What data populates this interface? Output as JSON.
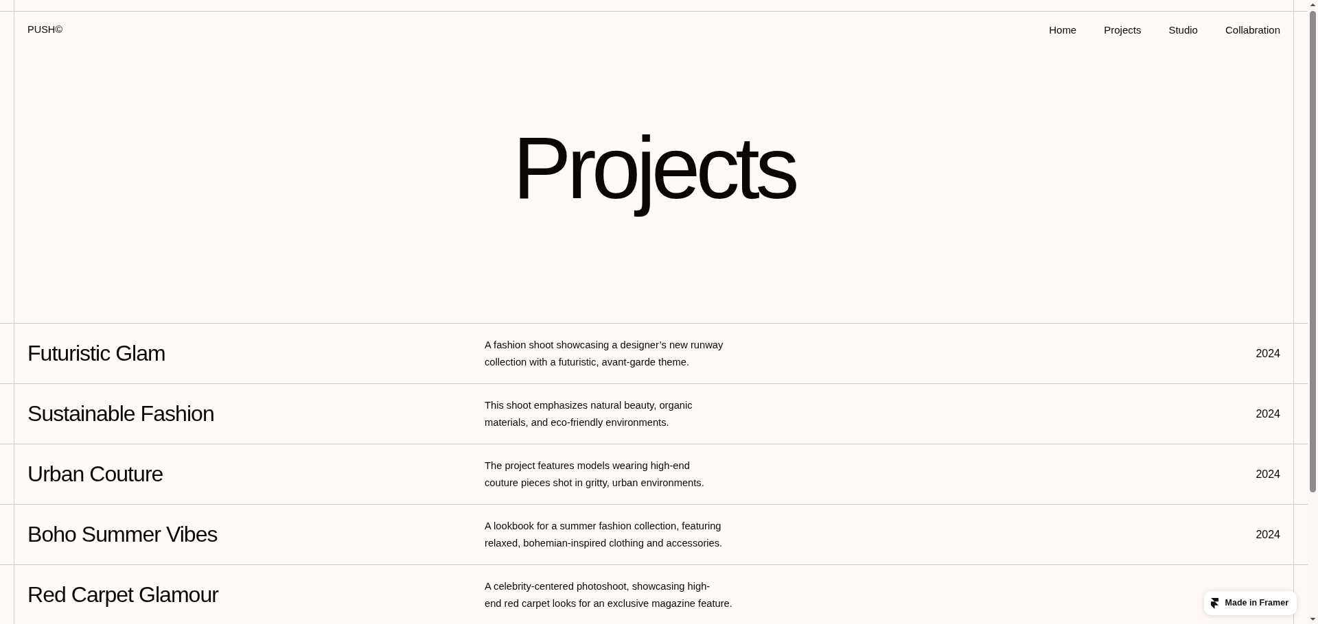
{
  "header": {
    "logo": "PUSH©",
    "nav": [
      {
        "label": "Home"
      },
      {
        "label": "Projects"
      },
      {
        "label": "Studio"
      },
      {
        "label": "Collabration"
      }
    ]
  },
  "hero": {
    "title": "Projects"
  },
  "projects": [
    {
      "title": "Futuristic Glam",
      "description": "A fashion shoot showcasing a designer’s new runway\ncollection with a futuristic, avant-garde theme.",
      "year": "2024"
    },
    {
      "title": "Sustainable Fashion",
      "description": "This shoot emphasizes natural beauty, organic\nmaterials, and eco-friendly environments.",
      "year": "2024"
    },
    {
      "title": "Urban Couture",
      "description": "The project features models wearing high-end\ncouture pieces shot in gritty, urban environments.",
      "year": "2024"
    },
    {
      "title": "Boho Summer Vibes",
      "description": "A lookbook for a summer fashion collection, featuring\nrelaxed, bohemian-inspired clothing and accessories.",
      "year": "2024"
    },
    {
      "title": "Red Carpet Glamour",
      "description": "A celebrity-centered photoshoot, showcasing high-\nend red carpet looks for an exclusive magazine feature."
    }
  ],
  "badge": {
    "label": "Made in Framer"
  }
}
